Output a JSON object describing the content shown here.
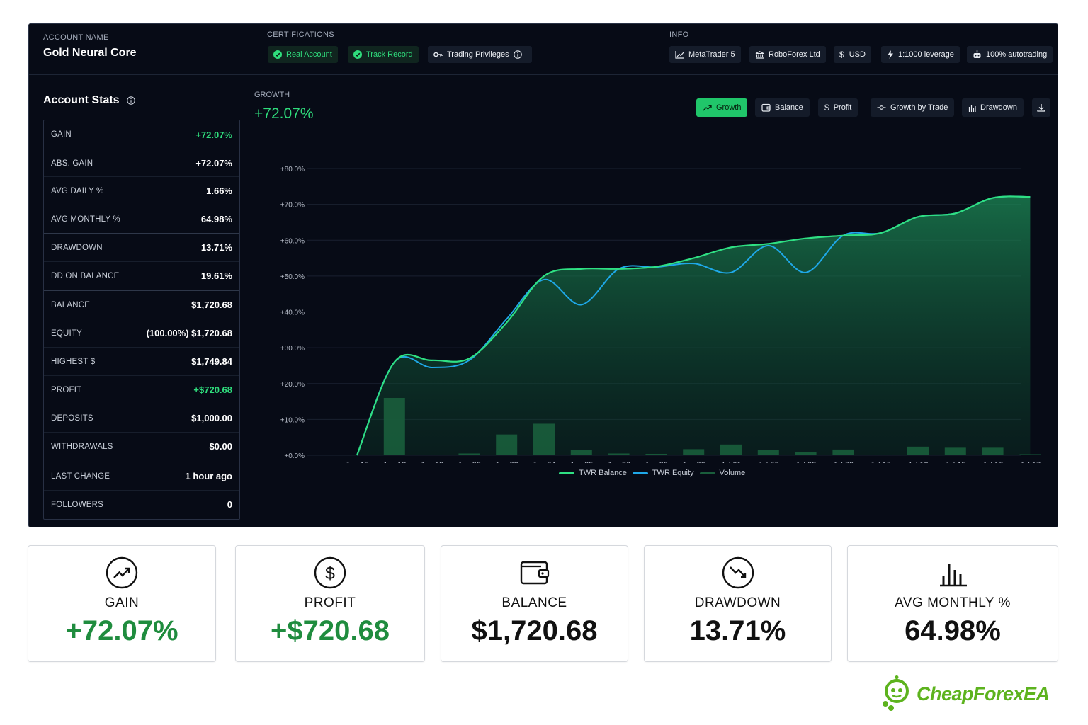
{
  "header": {
    "account_label": "ACCOUNT NAME",
    "account_name": "Gold Neural Core",
    "cert_label": "CERTIFICATIONS",
    "certs": [
      "Real Account",
      "Track Record",
      "Trading Privileges"
    ],
    "info_label": "INFO",
    "info": [
      "MetaTrader 5",
      "RoboForex Ltd",
      "USD",
      "1:1000 leverage",
      "100% autotrading"
    ]
  },
  "stats": {
    "title": "Account Stats",
    "rows": [
      {
        "key": "GAIN",
        "value": "+72.07%"
      },
      {
        "key": "ABS. GAIN",
        "value": "+72.07%"
      },
      {
        "key": "AVG DAILY %",
        "value": "1.66%"
      },
      {
        "key": "AVG MONTHLY %",
        "value": "64.98%"
      },
      {
        "key": "DRAWDOWN",
        "value": "13.71%"
      },
      {
        "key": "DD ON BALANCE",
        "value": "19.61%"
      },
      {
        "key": "BALANCE",
        "value": "$1,720.68"
      },
      {
        "key": "EQUITY",
        "value": "(100.00%) $1,720.68"
      },
      {
        "key": "HIGHEST $",
        "value": "$1,749.84"
      },
      {
        "key": "PROFIT",
        "value": "+$720.68"
      },
      {
        "key": "DEPOSITS",
        "value": "$1,000.00"
      },
      {
        "key": "WITHDRAWALS",
        "value": "$0.00"
      },
      {
        "key": "LAST CHANGE",
        "value": "1 hour ago"
      },
      {
        "key": "FOLLOWERS",
        "value": "0"
      }
    ]
  },
  "growth": {
    "label": "GROWTH",
    "value": "+72.07%"
  },
  "tabs": [
    "Growth",
    "Balance",
    "Profit",
    "Growth by Trade",
    "Drawdown"
  ],
  "chart_data": {
    "type": "line",
    "x": [
      "Jun 15",
      "Jun 18",
      "Jun 19",
      "Jun 22",
      "Jun 23",
      "Jun 24",
      "Jun 25",
      "Jun 26",
      "Jun 29",
      "Jun 30",
      "Jul 01",
      "Jul 07",
      "Jul 08",
      "Jul 09",
      "Jul 10",
      "Jul 13",
      "Jul 15",
      "Jul 16",
      "Jul 17"
    ],
    "y_ticks": [
      "+0.0%",
      "+10.0%",
      "+20.0%",
      "+30.0%",
      "+40.0%",
      "+50.0%",
      "+60.0%",
      "+70.0%",
      "+80.0%"
    ],
    "ylim": [
      0,
      80
    ],
    "series": [
      {
        "name": "TWR Balance",
        "color": "#2fe083",
        "values": [
          0,
          26,
          26.5,
          27,
          37,
          50,
          52,
          52,
          52.6,
          55,
          58,
          59,
          60.5,
          61.3,
          62,
          66.5,
          67.5,
          71.8,
          72.07
        ]
      },
      {
        "name": "TWR Equity",
        "color": "#1fa8e8",
        "values": [
          0,
          26,
          24.5,
          26.5,
          38,
          49,
          42,
          52,
          52.5,
          53.5,
          51,
          58.5,
          51,
          61.3,
          62,
          66.5,
          67.5,
          71.8,
          72.07
        ]
      },
      {
        "name": "Volume",
        "color": "#1a5e3c",
        "values": [
          0,
          16,
          0.2,
          0.5,
          5.8,
          8.8,
          1.4,
          0.5,
          0.4,
          1.7,
          3.0,
          1.4,
          0.9,
          1.6,
          0.2,
          2.4,
          2.1,
          2.1,
          0.3
        ]
      }
    ]
  },
  "cards": [
    {
      "label": "GAIN",
      "value": "+72.07%",
      "icon": "trend-up-circle-icon"
    },
    {
      "label": "PROFIT",
      "value": "+$720.68",
      "icon": "dollar-circle-icon"
    },
    {
      "label": "BALANCE",
      "value": "$1,720.68",
      "icon": "wallet-icon"
    },
    {
      "label": "DRAWDOWN",
      "value": "13.71%",
      "icon": "trend-down-circle-icon"
    },
    {
      "label": "AVG MONTHLY %",
      "value": "64.98%",
      "icon": "bar-chart-icon"
    }
  ],
  "brand": {
    "name": "CheapForexEA",
    "color": "#5db31e"
  },
  "colors": {
    "accent_green": "#2fdc7c",
    "panel_bg": "#070b16",
    "equity_blue": "#1fa8e8"
  }
}
